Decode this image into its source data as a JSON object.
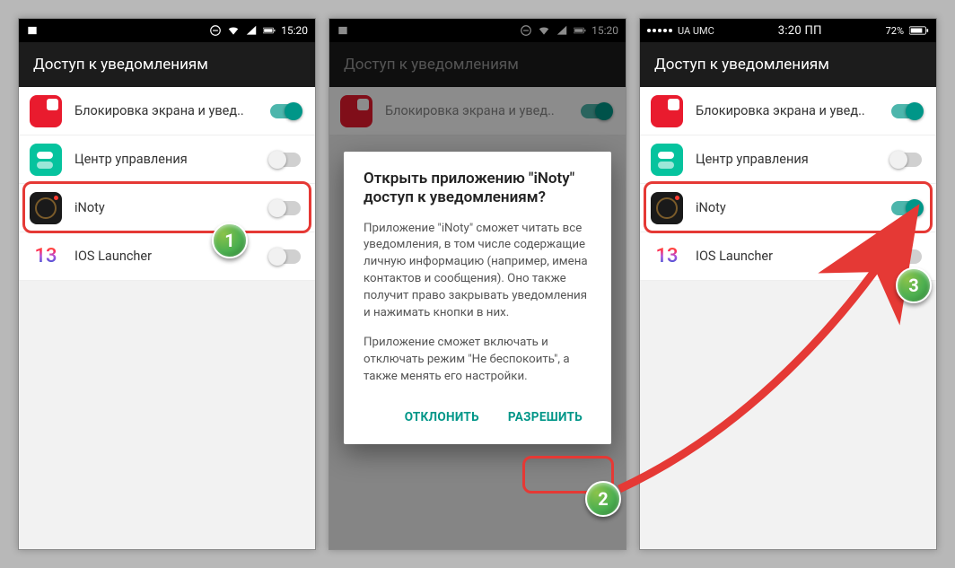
{
  "statusA": {
    "time": "15:20"
  },
  "status3": {
    "carrier": "UA UMC",
    "time": "3:20 ПП",
    "battery": "72%"
  },
  "appbarTitle": "Доступ к уведомлениям",
  "apps": {
    "lock": {
      "label": "Блокировка экрана и увед.."
    },
    "cc": {
      "label": "Центр управления"
    },
    "inoty": {
      "label": "iNoty"
    },
    "ios": {
      "label": "IOS Launcher",
      "icon13": "13"
    }
  },
  "dialog": {
    "title": "Открыть приложению \"iNoty\" доступ к уведомлениям?",
    "p1": "Приложение \"iNoty\" сможет читать все уведомления, в том числе содержащие личную информацию (например, имена контактов и сообщения). Оно также получит право закрывать уведомления и нажимать кнопки в них.",
    "p2": "Приложение сможет включать и отключать режим \"Не беспокоить\", а также менять его настройки.",
    "deny": "ОТКЛОНИТЬ",
    "allow": "РАЗРЕШИТЬ"
  },
  "badges": {
    "one": "1",
    "two": "2",
    "three": "3"
  }
}
